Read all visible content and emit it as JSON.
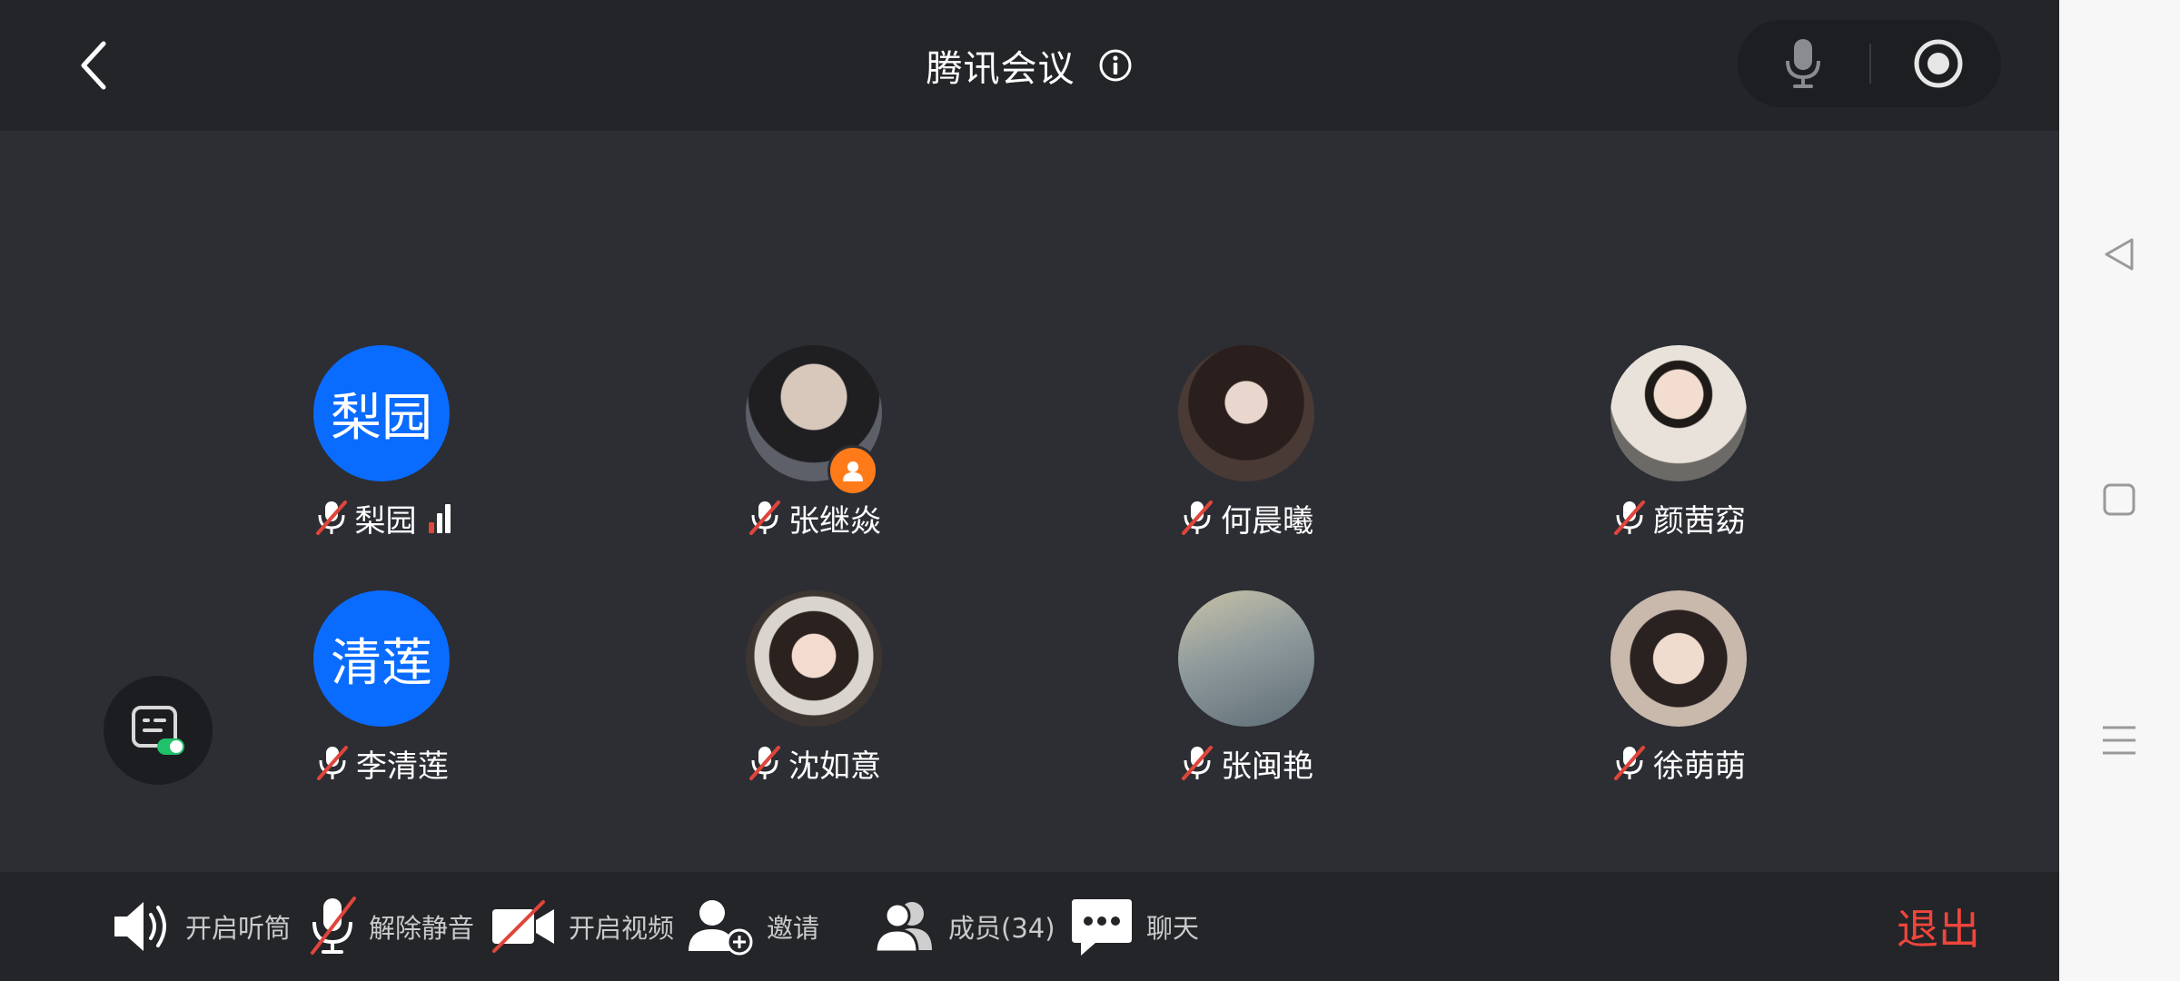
{
  "header": {
    "title": "腾讯会议"
  },
  "participants": [
    {
      "name": "梨园",
      "avatar_text": "梨园",
      "avatar_type": "text",
      "avatar_color": "#0a6cff",
      "has_signal": true,
      "signal_bars": [
        "#e0453c",
        "#ffffff",
        "#ffffff"
      ]
    },
    {
      "name": "张继焱",
      "avatar_type": "photo",
      "photo_tone": "#6b6f78",
      "host_badge": true
    },
    {
      "name": "何晨曦",
      "avatar_type": "photo",
      "photo_tone": "#4a3a35"
    },
    {
      "name": "颜茜窈",
      "avatar_type": "photo",
      "photo_tone": "#d8d0c6"
    },
    {
      "name": "李清莲",
      "avatar_text": "清莲",
      "avatar_type": "text",
      "avatar_color": "#0a6cff"
    },
    {
      "name": "沈如意",
      "avatar_type": "photo",
      "photo_tone": "#3d3532"
    },
    {
      "name": "张闽艳",
      "avatar_type": "photo",
      "photo_tone": "#8f9a9c"
    },
    {
      "name": "徐萌萌",
      "avatar_type": "photo",
      "photo_tone": "#b9a79a"
    }
  ],
  "toolbar": {
    "speaker_label": "开启听筒",
    "unmute_label": "解除静音",
    "video_label": "开启视频",
    "invite_label": "邀请",
    "members_label": "成员(34)",
    "chat_label": "聊天",
    "exit_label": "退出"
  },
  "colors": {
    "background": "#2c2e33",
    "bar": "#242528",
    "accent_blue": "#0a6cff",
    "danger_red": "#f0453c",
    "host_badge": "#ff7b1a"
  },
  "icons": {
    "back": "back-chevron-icon",
    "info": "info-icon",
    "mic": "microphone-icon",
    "record": "record-icon",
    "mute": "muted-mic-icon",
    "speaker": "speaker-icon",
    "video": "video-off-icon",
    "invite": "invite-user-icon",
    "members": "members-icon",
    "chat": "chat-bubble-icon",
    "caption": "caption-toggle-icon"
  }
}
